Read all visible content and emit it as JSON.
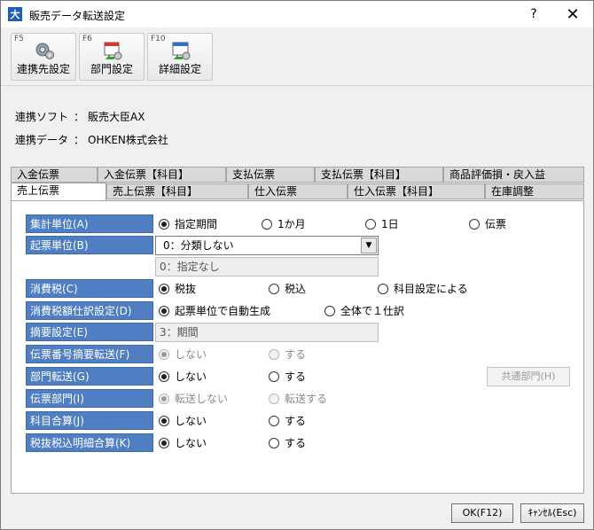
{
  "window": {
    "title": "販売データ転送設定",
    "app_icon_text": "大",
    "help_label": "?",
    "close_label": "✕"
  },
  "toolbar": {
    "buttons": [
      {
        "key": "F5",
        "label": "連携先設定",
        "icon": "gear-icon"
      },
      {
        "key": "F6",
        "label": "部門設定",
        "icon": "department-icon"
      },
      {
        "key": "F10",
        "label": "詳細設定",
        "icon": "detail-settings-icon"
      }
    ]
  },
  "info": {
    "soft_label": "連携ソフト",
    "soft_value": "販売大臣AX",
    "data_label": "連携データ",
    "data_value": "OHKEN株式会社",
    "colon": "："
  },
  "tabs": {
    "back_row": [
      "入金伝票",
      "入金伝票【科目】",
      "支払伝票",
      "支払伝票【科目】",
      "商品評価損・戻入益"
    ],
    "front_row": [
      "売上伝票",
      "売上伝票【科目】",
      "仕入伝票",
      "仕入伝票【科目】",
      "在庫調整"
    ],
    "active": "売上伝票"
  },
  "form": {
    "aggregate_unit": {
      "label": "集計単位(A)",
      "options": [
        "指定期間",
        "1か月",
        "1日",
        "伝票"
      ],
      "selected": "指定期間"
    },
    "voucher_unit": {
      "label": "起票単位(B)",
      "value": "0：分類しない",
      "sub_value": "0：指定なし"
    },
    "consumption_tax": {
      "label": "消費税(C)",
      "options": [
        "税抜",
        "税込",
        "科目設定による"
      ],
      "selected": "税抜"
    },
    "tax_entry": {
      "label": "消費税額仕訳設定(D)",
      "options": [
        "起票単位で自動生成",
        "全体で１仕訳"
      ],
      "selected": "起票単位で自動生成"
    },
    "summary": {
      "label": "摘要設定(E)",
      "value": "3：期間"
    },
    "voucher_number_summary": {
      "label": "伝票番号摘要転送(F)",
      "options": [
        "しない",
        "する"
      ],
      "selected": "しない",
      "disabled": true
    },
    "department_transfer": {
      "label": "部門転送(G)",
      "options": [
        "しない",
        "する"
      ],
      "selected": "しない",
      "side_button": "共通部門(H)"
    },
    "voucher_department": {
      "label": "伝票部門(I)",
      "options": [
        "転送しない",
        "転送する"
      ],
      "selected": "転送しない",
      "disabled": true
    },
    "account_sum": {
      "label": "科目合算(J)",
      "options": [
        "しない",
        "する"
      ],
      "selected": "しない"
    },
    "tax_detail_sum": {
      "label": "税抜税込明細合算(K)",
      "options": [
        "しない",
        "する"
      ],
      "selected": "しない"
    }
  },
  "footer": {
    "ok_label": "OK(F12)",
    "cancel_label": "ｷｬﾝｾﾙ(Esc)"
  },
  "colors": {
    "label_bg": "#4f7fc2",
    "panel_bg": "#ffffff",
    "window_bg": "#f0f0f0"
  }
}
